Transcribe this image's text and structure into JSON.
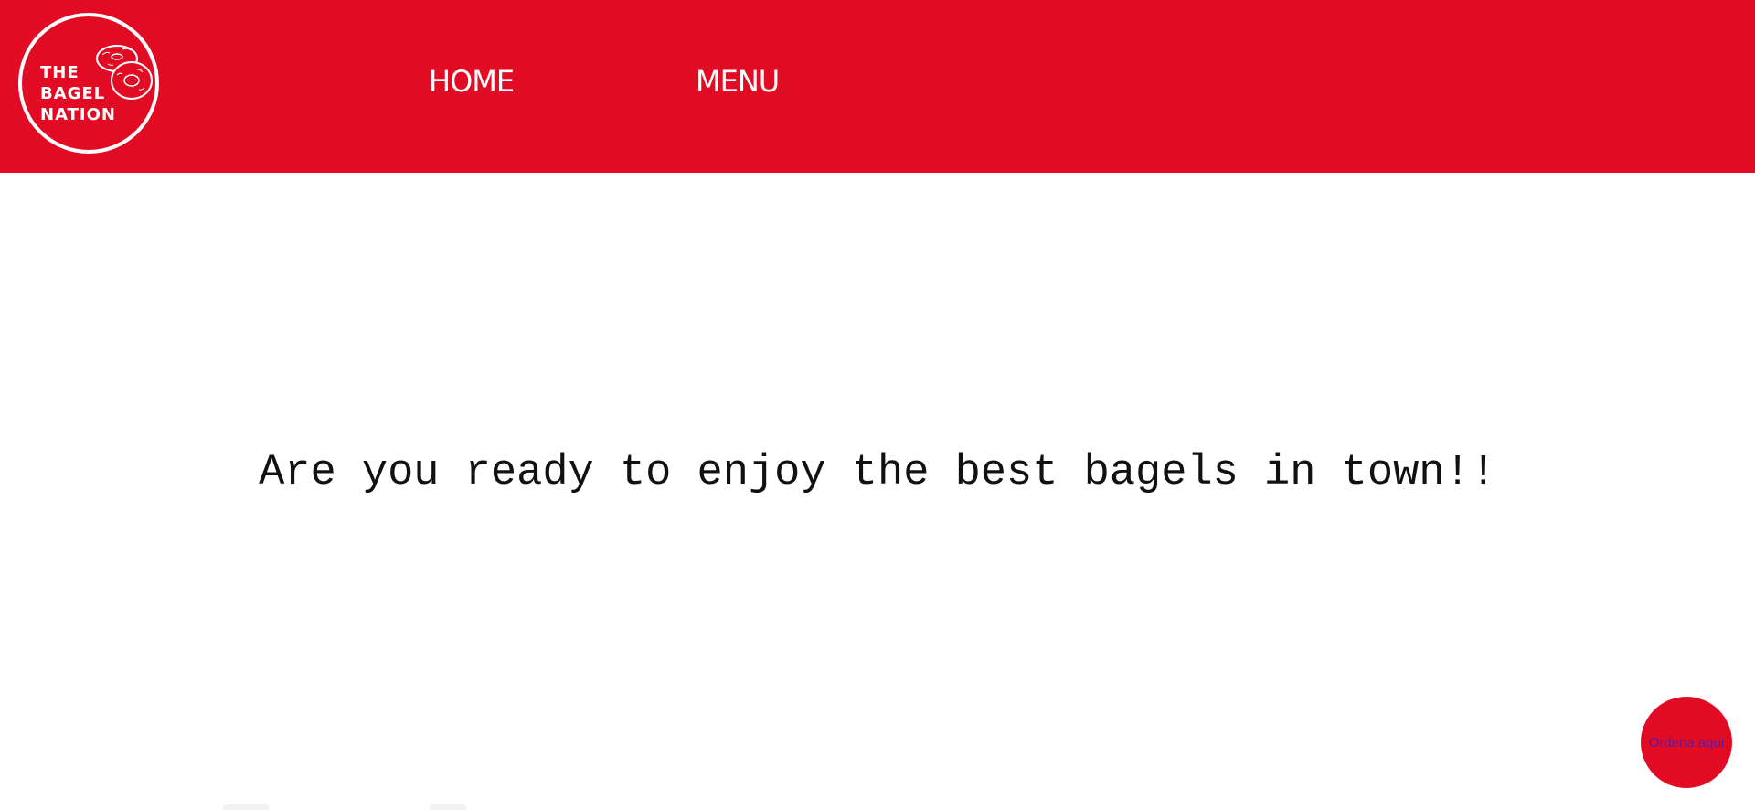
{
  "header": {
    "background_color": "#e10c23",
    "logo": {
      "lines": [
        "THE",
        "BAGEL",
        "NATION"
      ],
      "icon": "bagel-icon"
    },
    "nav": {
      "home_label": "HOME",
      "menu_label": "MENU"
    }
  },
  "main": {
    "headline": "Are you ready to enjoy the best bagels in town!!"
  },
  "order_button": {
    "label": "Ordena aqui",
    "color": "#e10c23",
    "label_color": "#5a1aa8"
  }
}
